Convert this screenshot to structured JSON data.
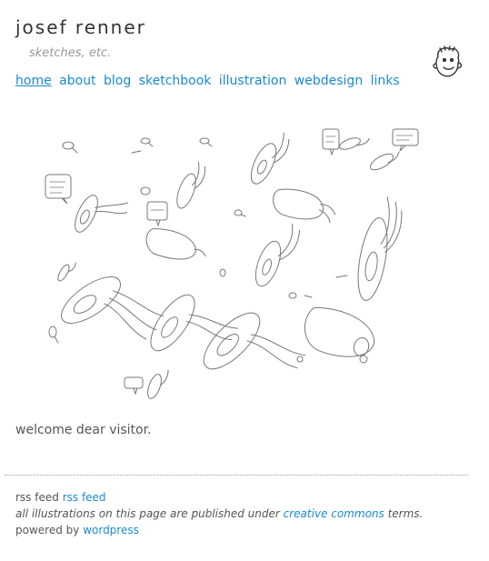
{
  "header": {
    "site_title": "josef renner",
    "tagline": "sketches, etc."
  },
  "nav": {
    "items": [
      {
        "label": "home"
      },
      {
        "label": "about"
      },
      {
        "label": "blog"
      },
      {
        "label": "sketchbook"
      },
      {
        "label": "illustration"
      },
      {
        "label": "webdesign"
      },
      {
        "label": "links"
      }
    ]
  },
  "main": {
    "welcome": "welcome dear visitor."
  },
  "footer": {
    "rss_text": "rss feed",
    "rss_link": "rss feed",
    "license_prefix": "all illustrations on this page are published under",
    "license_link": "creative commons",
    "license_suffix": "terms.",
    "powered_prefix": "powered by",
    "powered_link": "wordpress"
  },
  "colors": {
    "link": "#1a8ad0",
    "text": "#555555",
    "tagline": "#999999"
  }
}
